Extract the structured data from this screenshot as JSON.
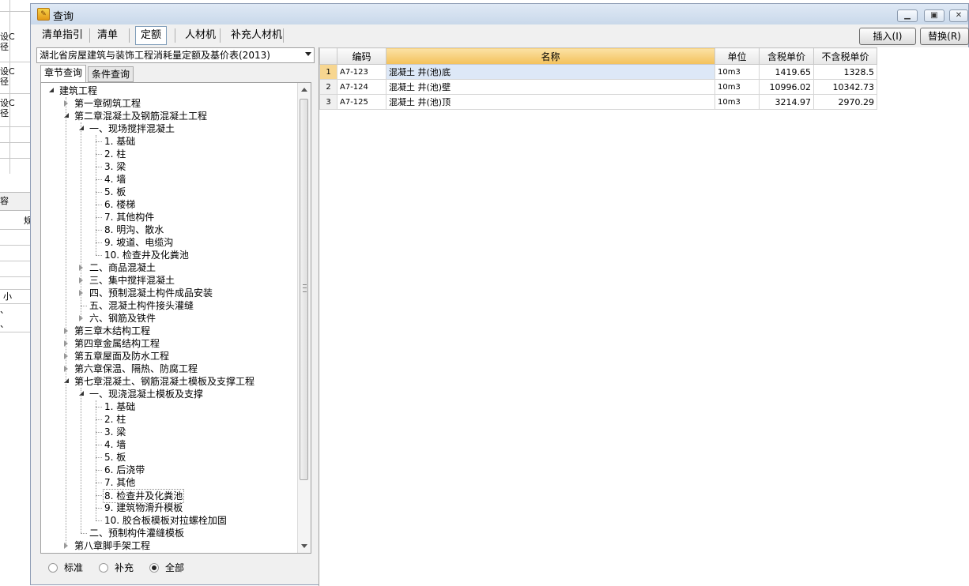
{
  "background_app": {
    "cells": [
      "设C",
      "径",
      "设C",
      "径",
      "设C",
      "径",
      "容",
      "规",
      "小",
      "、",
      "、"
    ]
  },
  "window": {
    "title": "查询",
    "minimize_glyph": "▁",
    "maximize_glyph": "▣",
    "close_glyph": "✕"
  },
  "top_tabs": [
    {
      "label": "清单指引"
    },
    {
      "label": "清单"
    },
    {
      "label": "定额"
    },
    {
      "label": "人材机"
    },
    {
      "label": "补充人材机"
    }
  ],
  "actions": {
    "insert_label": "插入(I)",
    "replace_label": "替换(R)"
  },
  "quota_select": {
    "value": "湖北省房屋建筑与装饰工程消耗量定额及基价表(2013)"
  },
  "sub_tabs": [
    {
      "label": "章节查询"
    },
    {
      "label": "条件查询"
    }
  ],
  "tree": {
    "nodes": [
      {
        "label": "建筑工程",
        "level": 0,
        "state": "expanded"
      },
      {
        "label": "第一章砌筑工程",
        "level": 1,
        "state": "collapsed"
      },
      {
        "label": "第二章混凝土及钢筋混凝土工程",
        "level": 1,
        "state": "expanded"
      },
      {
        "label": "一、现场搅拌混凝土",
        "level": 2,
        "state": "expanded"
      },
      {
        "label": "1. 基础",
        "level": 3,
        "state": "leaf"
      },
      {
        "label": "2. 柱",
        "level": 3,
        "state": "leaf"
      },
      {
        "label": "3. 梁",
        "level": 3,
        "state": "leaf"
      },
      {
        "label": "4. 墙",
        "level": 3,
        "state": "leaf"
      },
      {
        "label": "5. 板",
        "level": 3,
        "state": "leaf"
      },
      {
        "label": "6. 楼梯",
        "level": 3,
        "state": "leaf"
      },
      {
        "label": "7. 其他构件",
        "level": 3,
        "state": "leaf"
      },
      {
        "label": "8. 明沟、散水",
        "level": 3,
        "state": "leaf"
      },
      {
        "label": "9. 坡道、电缆沟",
        "level": 3,
        "state": "leaf"
      },
      {
        "label": "10. 检查井及化粪池",
        "level": 3,
        "state": "leaf"
      },
      {
        "label": "二、商品混凝土",
        "level": 2,
        "state": "collapsed"
      },
      {
        "label": "三、集中搅拌混凝土",
        "level": 2,
        "state": "collapsed"
      },
      {
        "label": "四、预制混凝土构件成品安装",
        "level": 2,
        "state": "collapsed"
      },
      {
        "label": "五、混凝土构件接头灌缝",
        "level": 2,
        "state": "leaf"
      },
      {
        "label": "六、钢筋及铁件",
        "level": 2,
        "state": "collapsed"
      },
      {
        "label": "第三章木结构工程",
        "level": 1,
        "state": "collapsed"
      },
      {
        "label": "第四章金属结构工程",
        "level": 1,
        "state": "collapsed"
      },
      {
        "label": "第五章屋面及防水工程",
        "level": 1,
        "state": "collapsed"
      },
      {
        "label": "第六章保温、隔热、防腐工程",
        "level": 1,
        "state": "collapsed"
      },
      {
        "label": "第七章混凝土、钢筋混凝土模板及支撑工程",
        "level": 1,
        "state": "expanded"
      },
      {
        "label": "一、现浇混凝土模板及支撑",
        "level": 2,
        "state": "expanded"
      },
      {
        "label": "1. 基础",
        "level": 3,
        "state": "leaf"
      },
      {
        "label": "2. 柱",
        "level": 3,
        "state": "leaf"
      },
      {
        "label": "3. 梁",
        "level": 3,
        "state": "leaf"
      },
      {
        "label": "4. 墙",
        "level": 3,
        "state": "leaf"
      },
      {
        "label": "5. 板",
        "level": 3,
        "state": "leaf"
      },
      {
        "label": "6. 后浇带",
        "level": 3,
        "state": "leaf"
      },
      {
        "label": "7. 其他",
        "level": 3,
        "state": "leaf"
      },
      {
        "label": "8. 检查井及化粪池",
        "level": 3,
        "state": "leaf",
        "selected": true
      },
      {
        "label": "9. 建筑物滑升模板",
        "level": 3,
        "state": "leaf"
      },
      {
        "label": "10. 胶合板模板对拉螺栓加固",
        "level": 3,
        "state": "leaf"
      },
      {
        "label": "二、预制构件灌缝模板",
        "level": 2,
        "state": "leaf"
      },
      {
        "label": "第八章脚手架工程",
        "level": 1,
        "state": "collapsed"
      }
    ]
  },
  "filter": {
    "options": [
      {
        "label": "标准",
        "checked": false
      },
      {
        "label": "补充",
        "checked": false
      },
      {
        "label": "全部",
        "checked": true
      }
    ]
  },
  "grid": {
    "columns": [
      "",
      "编码",
      "名称",
      "单位",
      "含税单价",
      "不含税单价"
    ],
    "rows": [
      {
        "no": "1",
        "code": "A7-123",
        "name": "混凝土 井(池)底",
        "unit": "10m3",
        "price_tax": "1419.65",
        "price_notax": "1328.5"
      },
      {
        "no": "2",
        "code": "A7-124",
        "name": "混凝土 井(池)壁",
        "unit": "10m3",
        "price_tax": "10996.02",
        "price_notax": "10342.73"
      },
      {
        "no": "3",
        "code": "A7-125",
        "name": "混凝土 井(池)顶",
        "unit": "10m3",
        "price_tax": "3214.97",
        "price_notax": "2970.29"
      }
    ]
  }
}
